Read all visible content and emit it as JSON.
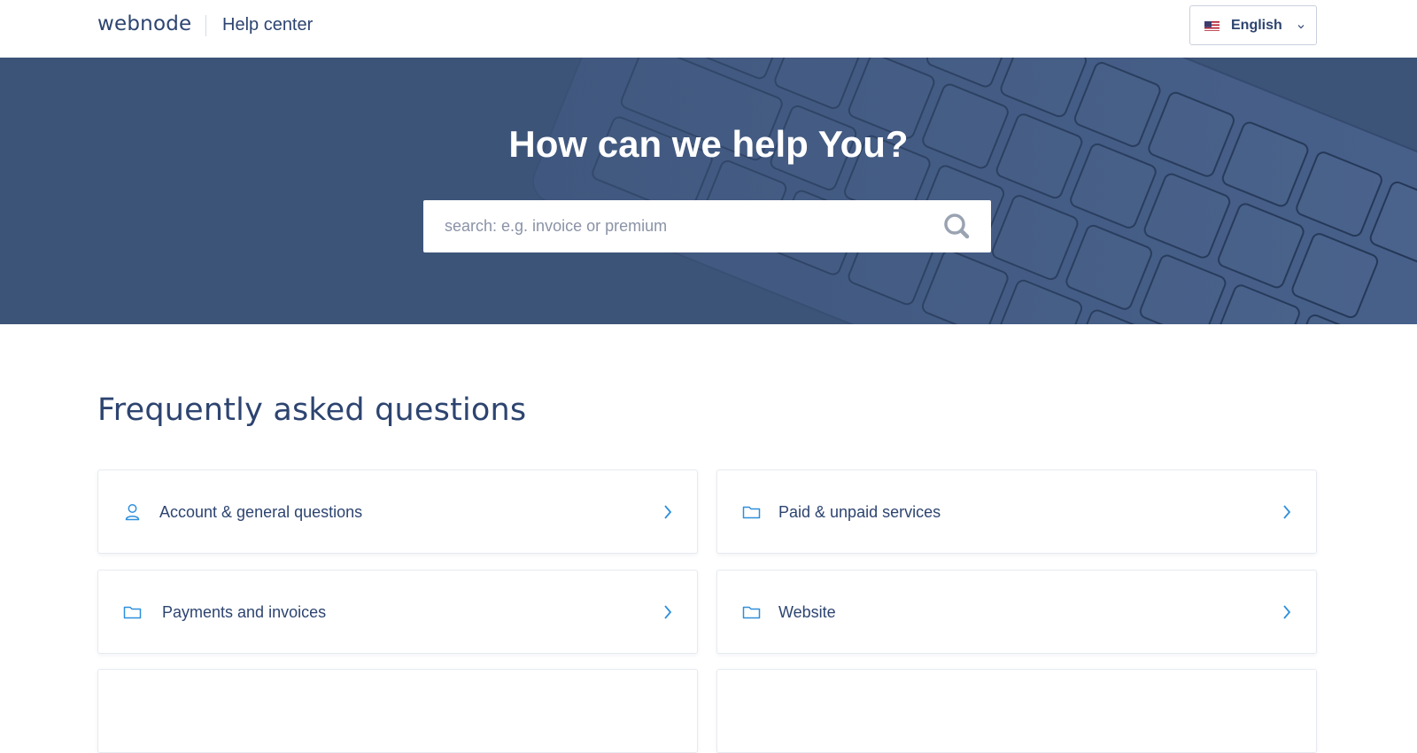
{
  "header": {
    "logo": "webnode",
    "section_title": "Help center",
    "language": {
      "label": "English",
      "flag": "us-flag-icon"
    }
  },
  "hero": {
    "title": "How can we help You?",
    "search": {
      "placeholder": "search: e.g. invoice or premium",
      "value": "",
      "icon": "search-icon"
    }
  },
  "faq": {
    "title": "Frequently asked questions",
    "items": [
      {
        "label": "Account & general questions",
        "icon": "user-icon"
      },
      {
        "label": "Paid & unpaid services",
        "icon": "folder-icon"
      },
      {
        "label": "Payments and invoices",
        "icon": "folder-icon"
      },
      {
        "label": "Website",
        "icon": "folder-icon"
      }
    ]
  },
  "colors": {
    "brand": "#2d4470",
    "accent": "#2f8fdb",
    "hero_bg": "#3d5479"
  }
}
